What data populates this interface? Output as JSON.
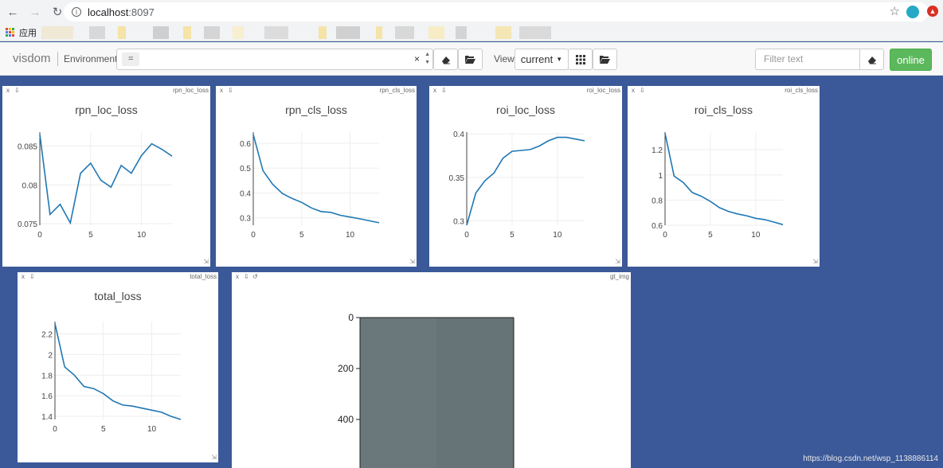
{
  "browser": {
    "url_host": "localhost",
    "url_port": ":8097",
    "bookmarks_label": "应用"
  },
  "toolbar": {
    "brand": "visdom",
    "env_label": "Environment",
    "env_chip": "=",
    "env_clear": "×",
    "view_label": "View",
    "view_value": "current",
    "filter_placeholder": "Filter text",
    "online_label": "online"
  },
  "panes": [
    {
      "window_title": "rpn_loc_loss",
      "chart_index": 0
    },
    {
      "window_title": "rpn_cls_loss",
      "chart_index": 1
    },
    {
      "window_title": "roi_loc_loss",
      "chart_index": 2
    },
    {
      "window_title": "roi_cls_loss",
      "chart_index": 3
    },
    {
      "window_title": "total_loss",
      "chart_index": 4
    },
    {
      "window_title": "gt_img"
    }
  ],
  "chart_data": [
    {
      "type": "line",
      "title": "rpn_loc_loss",
      "x": [
        0,
        1,
        2,
        3,
        4,
        5,
        6,
        7,
        8,
        9,
        10,
        11,
        12,
        13
      ],
      "y": [
        0.0865,
        0.0762,
        0.0775,
        0.0751,
        0.0815,
        0.0828,
        0.0806,
        0.0797,
        0.0825,
        0.0815,
        0.0838,
        0.0853,
        0.0846,
        0.0837
      ],
      "xticks": [
        0,
        5,
        10
      ],
      "yticks": [
        0.075,
        0.08,
        0.085
      ],
      "ytick_labels": [
        "0.075",
        "0.08",
        "0.085"
      ],
      "xlim": [
        0,
        13
      ],
      "ylim": [
        0.0748,
        0.0868
      ],
      "color": "#1f77b4"
    },
    {
      "type": "line",
      "title": "rpn_cls_loss",
      "x": [
        0,
        1,
        2,
        3,
        4,
        5,
        6,
        7,
        8,
        9,
        10,
        11,
        12,
        13
      ],
      "y": [
        0.635,
        0.49,
        0.435,
        0.398,
        0.378,
        0.362,
        0.34,
        0.325,
        0.322,
        0.31,
        0.303,
        0.296,
        0.288,
        0.28
      ],
      "xticks": [
        0,
        5,
        10
      ],
      "yticks": [
        0.3,
        0.4,
        0.5,
        0.6
      ],
      "ytick_labels": [
        "0.3",
        "0.4",
        "0.5",
        "0.6"
      ],
      "xlim": [
        0,
        13
      ],
      "ylim": [
        0.27,
        0.645
      ],
      "color": "#1f77b4"
    },
    {
      "type": "line",
      "title": "roi_loc_loss",
      "x": [
        0,
        1,
        2,
        3,
        4,
        5,
        6,
        7,
        8,
        9,
        10,
        11,
        12,
        13
      ],
      "y": [
        0.295,
        0.332,
        0.346,
        0.355,
        0.372,
        0.38,
        0.381,
        0.382,
        0.386,
        0.392,
        0.396,
        0.396,
        0.394,
        0.392
      ],
      "xticks": [
        0,
        5,
        10
      ],
      "yticks": [
        0.3,
        0.35,
        0.4
      ],
      "ytick_labels": [
        "0.3",
        "0.35",
        "0.4"
      ],
      "xlim": [
        0,
        13
      ],
      "ylim": [
        0.295,
        0.402
      ],
      "color": "#1f77b4"
    },
    {
      "type": "line",
      "title": "roi_cls_loss",
      "x": [
        0,
        1,
        2,
        3,
        4,
        5,
        6,
        7,
        8,
        9,
        10,
        11,
        12,
        13
      ],
      "y": [
        1.33,
        0.99,
        0.94,
        0.86,
        0.83,
        0.79,
        0.74,
        0.71,
        0.69,
        0.675,
        0.655,
        0.645,
        0.625,
        0.605
      ],
      "xticks": [
        0,
        5,
        10
      ],
      "yticks": [
        0.6,
        0.8,
        1,
        1.2
      ],
      "ytick_labels": [
        "0.6",
        "0.8",
        "1",
        "1.2"
      ],
      "xlim": [
        0,
        13
      ],
      "ylim": [
        0.6,
        1.34
      ],
      "color": "#1f77b4"
    },
    {
      "type": "line",
      "title": "total_loss",
      "x": [
        0,
        1,
        2,
        3,
        4,
        5,
        6,
        7,
        8,
        9,
        10,
        11,
        12,
        13
      ],
      "y": [
        2.3,
        1.88,
        1.8,
        1.69,
        1.67,
        1.62,
        1.55,
        1.51,
        1.5,
        1.48,
        1.46,
        1.44,
        1.4,
        1.37
      ],
      "xticks": [
        0,
        5,
        10
      ],
      "yticks": [
        1.4,
        1.6,
        1.8,
        2,
        2.2
      ],
      "ytick_labels": [
        "1.4",
        "1.6",
        "1.8",
        "2",
        "2.2"
      ],
      "xlim": [
        0,
        13
      ],
      "ylim": [
        1.37,
        2.32
      ],
      "color": "#1f77b4"
    },
    {
      "type": "heatmap",
      "title": "gt_img",
      "yticks": [
        0,
        200,
        400
      ],
      "ytick_labels": [
        "0",
        "200",
        "400"
      ],
      "color": "#667377"
    }
  ],
  "watermark": "https://blog.csdn.net/wsp_1138886114"
}
